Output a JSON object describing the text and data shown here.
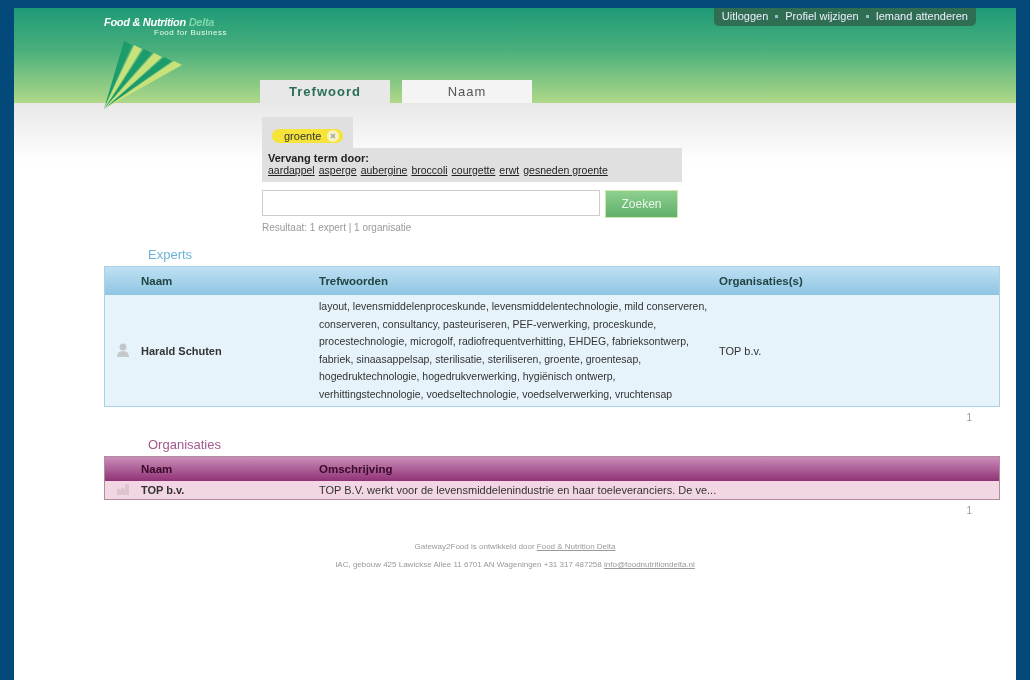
{
  "logo": {
    "name": "Food & Nutrition",
    "accent": "Delta",
    "tagline": "Food for Business"
  },
  "top_links": [
    "Uitloggen",
    "Profiel wijzigen",
    "Iemand attenderen"
  ],
  "tabs": [
    {
      "label": "Trefwoord",
      "selected": true
    },
    {
      "label": "Naam",
      "selected": false
    }
  ],
  "search_term": {
    "label": "groente"
  },
  "replace": {
    "heading": "Vervang term door:",
    "terms": [
      "aardappel",
      "asperge",
      "aubergine",
      "broccoli",
      "courgette",
      "erwt",
      "gesneden groente"
    ]
  },
  "search": {
    "button": "Zoeken"
  },
  "result_summary": "Resultaat: 1 expert | 1 organisatie",
  "experts": {
    "title": "Experts",
    "columns": [
      "Naam",
      "Trefwoorden",
      "Organisaties(s)"
    ],
    "rows": [
      {
        "name": "Harald Schuten",
        "keywords": "layout, levensmiddelenproceskunde, levensmiddelentechnologie, mild conserveren, conserveren, consultancy, pasteuriseren, PEF-verwerking, proceskunde, procestechnologie, microgolf, radiofrequentverhitting, EHDEG, fabrieksontwerp, fabriek, sinaasappelsap, sterilisatie, steriliseren, groente, groentesap, hogedruktechnologie, hogedrukverwerking, hygiënisch ontwerp, verhittingstechnologie, voedseltechnologie, voedselverwerking, vruchtensap",
        "organisation": "TOP b.v."
      }
    ],
    "page": "1"
  },
  "organisations": {
    "title": "Organisaties",
    "columns": [
      "Naam",
      "Omschrijving"
    ],
    "rows": [
      {
        "name": "TOP b.v.",
        "description": "TOP B.V. werkt voor de levensmiddelenindustrie en haar toeleveranciers. De ve..."
      }
    ],
    "page": "1"
  },
  "footer": {
    "credit": "Gateway2Food is ontwikkeld door",
    "credit_link": "Food & Nutrition Delta",
    "address": "IAC, gebouw 425   Lawickse Allee 11   6701 AN Wageningen   +31 317 487258",
    "email": "info@foodnutritiondelta.nl"
  }
}
